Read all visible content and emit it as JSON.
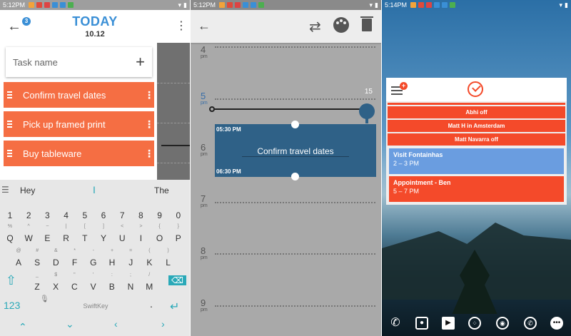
{
  "panel1": {
    "status": {
      "time": "5:12PM"
    },
    "header": {
      "badge": "3",
      "title": "TODAY",
      "date": "10.12"
    },
    "task_input": {
      "placeholder": "Task name"
    },
    "tasks": [
      {
        "label": "Confirm travel dates"
      },
      {
        "label": "Pick up framed print"
      },
      {
        "label": "Buy tableware"
      }
    ],
    "keyboard": {
      "suggestions": [
        "Hey",
        "I",
        "The"
      ],
      "row1": [
        {
          "main": "1",
          "sub": ""
        },
        {
          "main": "2",
          "sub": ""
        },
        {
          "main": "3",
          "sub": ""
        },
        {
          "main": "4",
          "sub": ""
        },
        {
          "main": "5",
          "sub": ""
        },
        {
          "main": "6",
          "sub": ""
        },
        {
          "main": "7",
          "sub": ""
        },
        {
          "main": "8",
          "sub": ""
        },
        {
          "main": "9",
          "sub": ""
        },
        {
          "main": "0",
          "sub": ""
        }
      ],
      "row2": [
        {
          "main": "Q",
          "sub": "%"
        },
        {
          "main": "W",
          "sub": "^"
        },
        {
          "main": "E",
          "sub": "~"
        },
        {
          "main": "R",
          "sub": "|"
        },
        {
          "main": "T",
          "sub": "["
        },
        {
          "main": "Y",
          "sub": "]"
        },
        {
          "main": "U",
          "sub": "<"
        },
        {
          "main": "I",
          "sub": ">"
        },
        {
          "main": "O",
          "sub": "{"
        },
        {
          "main": "P",
          "sub": "}"
        }
      ],
      "row3": [
        {
          "main": "A",
          "sub": "@"
        },
        {
          "main": "S",
          "sub": "#"
        },
        {
          "main": "D",
          "sub": "&"
        },
        {
          "main": "F",
          "sub": "*"
        },
        {
          "main": "G",
          "sub": "-"
        },
        {
          "main": "H",
          "sub": "+"
        },
        {
          "main": "J",
          "sub": "="
        },
        {
          "main": "K",
          "sub": "("
        },
        {
          "main": "L",
          "sub": ")"
        }
      ],
      "row4": [
        {
          "main": "Z",
          "sub": "_"
        },
        {
          "main": "X",
          "sub": "$"
        },
        {
          "main": "C",
          "sub": "\""
        },
        {
          "main": "V",
          "sub": "'"
        },
        {
          "main": "B",
          "sub": ":"
        },
        {
          "main": "N",
          "sub": ";"
        },
        {
          "main": "M",
          "sub": "/"
        }
      ],
      "num_key": "123",
      "space_label": "SwiftKey",
      "period_key": "."
    }
  },
  "panel2": {
    "status": {
      "time": "5:12PM"
    },
    "hours": [
      {
        "num": "4",
        "ampm": "pm"
      },
      {
        "num": "5",
        "ampm": "pm"
      },
      {
        "num": "6",
        "ampm": "pm"
      },
      {
        "num": "7",
        "ampm": "pm"
      },
      {
        "num": "8",
        "ampm": "pm"
      },
      {
        "num": "9",
        "ampm": "pm"
      }
    ],
    "minute_label": "15",
    "event": {
      "start": "05:30 PM",
      "title": "Confirm travel dates",
      "end": "06:30 PM"
    }
  },
  "panel3": {
    "status": {
      "time": "5:14PM"
    },
    "all_day": [
      "Abhi off",
      "Matt H in Amsterdam",
      "Matt Navarra off"
    ],
    "events": [
      {
        "title": "Visit Fontainhas",
        "time": "2 – 3 PM",
        "color": "#6a9de0"
      },
      {
        "title": "Appointment - Ben",
        "time": "5 – 7 PM",
        "color": "#f44a2a"
      }
    ],
    "dock": [
      "phone-icon",
      "camera-icon",
      "play-store-icon",
      "apps-icon",
      "chrome-icon",
      "whatsapp-icon",
      "messages-icon"
    ]
  },
  "colors": {
    "accent_blue": "#3a8fd6",
    "task_orange": "#f56e43",
    "event_blue": "#2f6187",
    "widget_red": "#f44a2a"
  }
}
